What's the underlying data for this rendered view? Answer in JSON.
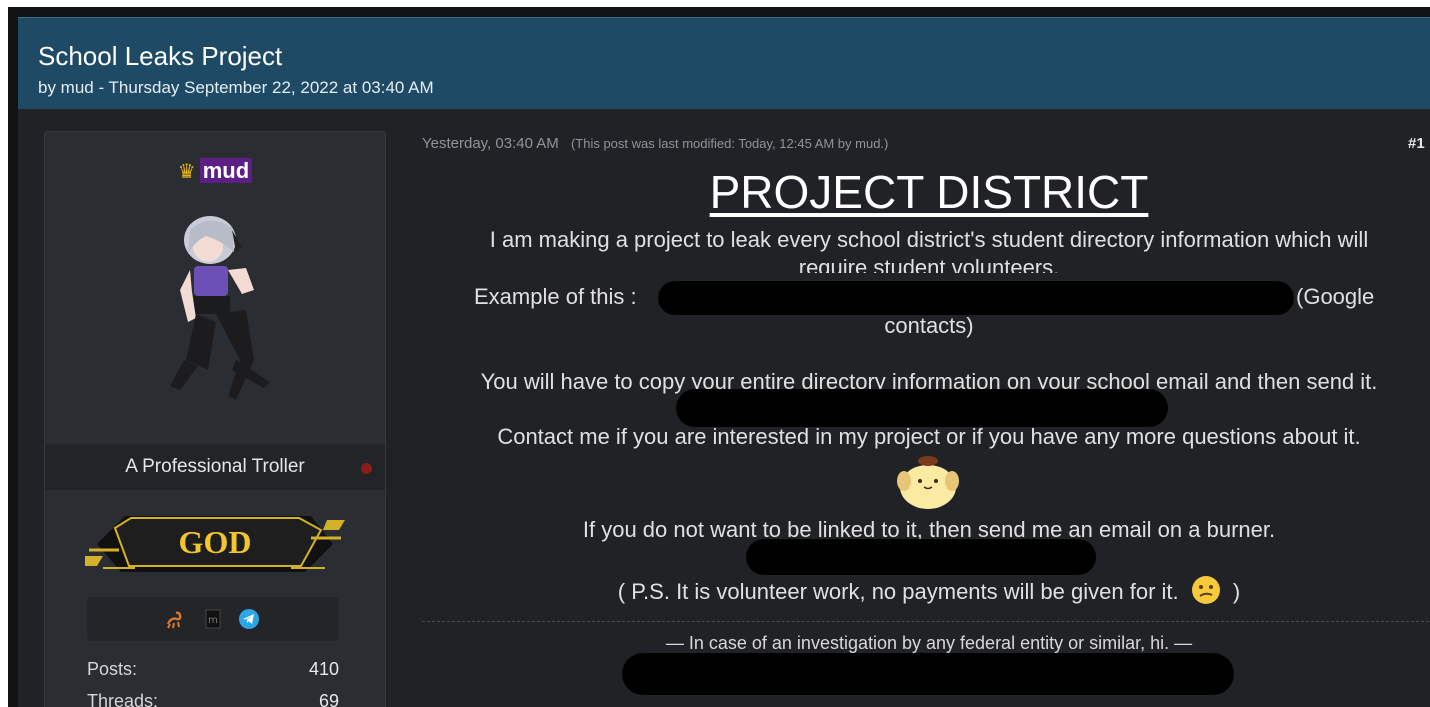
{
  "thread": {
    "title": "School Leaks Project",
    "meta": "by mud - Thursday September 22, 2022 at 03:40 AM"
  },
  "user": {
    "name": "mud",
    "title": "A Professional Troller",
    "rank": "GOD",
    "stats": [
      {
        "label": "Posts:",
        "value": "410"
      },
      {
        "label": "Threads:",
        "value": "69"
      }
    ],
    "icons": [
      "crown-icon",
      "scorpion-icon",
      "m-icon",
      "telegram-icon"
    ],
    "colors": {
      "name_bg": "#5b1f86",
      "crown": "#e8b81e",
      "status": "#8c1c1c"
    }
  },
  "post": {
    "date": "Yesterday, 03:40 AM",
    "modified": "(This post was last modified: Today, 12:45 AM by mud.)",
    "number": "#1",
    "heading": "PROJECT DISTRICT",
    "line1": "I am making a project to leak every school district's student directory information which will",
    "line1b": "require student volunteers.",
    "example_prefix": "Example of this :",
    "example_suffix": "(Google",
    "example_suffix2": "contacts)",
    "line2": "You will have to copy your entire directory information on your school email and then send it.",
    "line3": "Contact me if you are interested in my project or if you have any more questions about it.",
    "line4": "If you do not want to be linked to it, then send me an email on a burner.",
    "line5": "( P.S. It is volunteer work, no payments will be given for it.",
    "line5_end": ")",
    "signature": "— In case of an investigation by any federal entity or similar, hi. —"
  }
}
